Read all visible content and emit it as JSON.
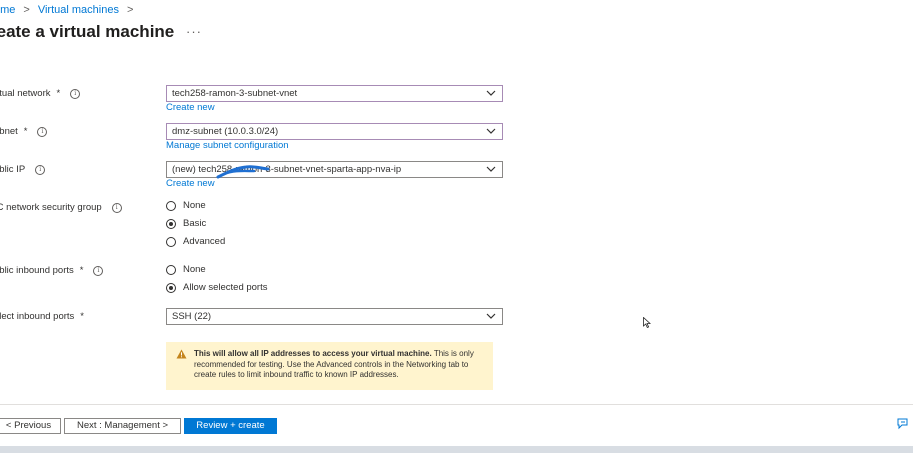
{
  "breadcrumb": {
    "items": [
      "ome",
      "Virtual machines"
    ],
    "sep": ">"
  },
  "page": {
    "title": "reate a virtual machine",
    "more": "···"
  },
  "fields": {
    "vnet": {
      "label": "irtual network",
      "required": "*",
      "value": "tech258-ramon-3-subnet-vnet",
      "link": "Create new"
    },
    "subnet": {
      "label": "ubnet",
      "required": "*",
      "value": "dmz-subnet (10.0.3.0/24)",
      "link": "Manage subnet configuration"
    },
    "public_ip": {
      "label": "ublic IP",
      "value": "(new) tech258-ramon-3-subnet-vnet-sparta-app-nva-ip",
      "link": "Create new"
    },
    "nsg": {
      "label": "IC network security group",
      "options": [
        "None",
        "Basic",
        "Advanced"
      ],
      "selected": "Basic"
    },
    "inbound": {
      "label": "ublic inbound ports",
      "required": "*",
      "options": [
        "None",
        "Allow selected ports"
      ],
      "selected": "Allow selected ports"
    },
    "select_ports": {
      "label": "elect inbound ports",
      "required": "*",
      "value": "SSH (22)"
    }
  },
  "warning": {
    "bold": "This will allow all IP addresses to access your virtual machine.",
    "text": " This is only recommended for testing.  Use the Advanced controls in the Networking tab to create rules to limit inbound traffic to known IP addresses."
  },
  "footer": {
    "previous": "< Previous",
    "next": "Next : Management >",
    "review": "Review + create"
  },
  "colors": {
    "accent": "#0078d4",
    "warning_bg": "#fff4ce",
    "warning_icon": "#c4851c",
    "required": "#a4262c"
  }
}
